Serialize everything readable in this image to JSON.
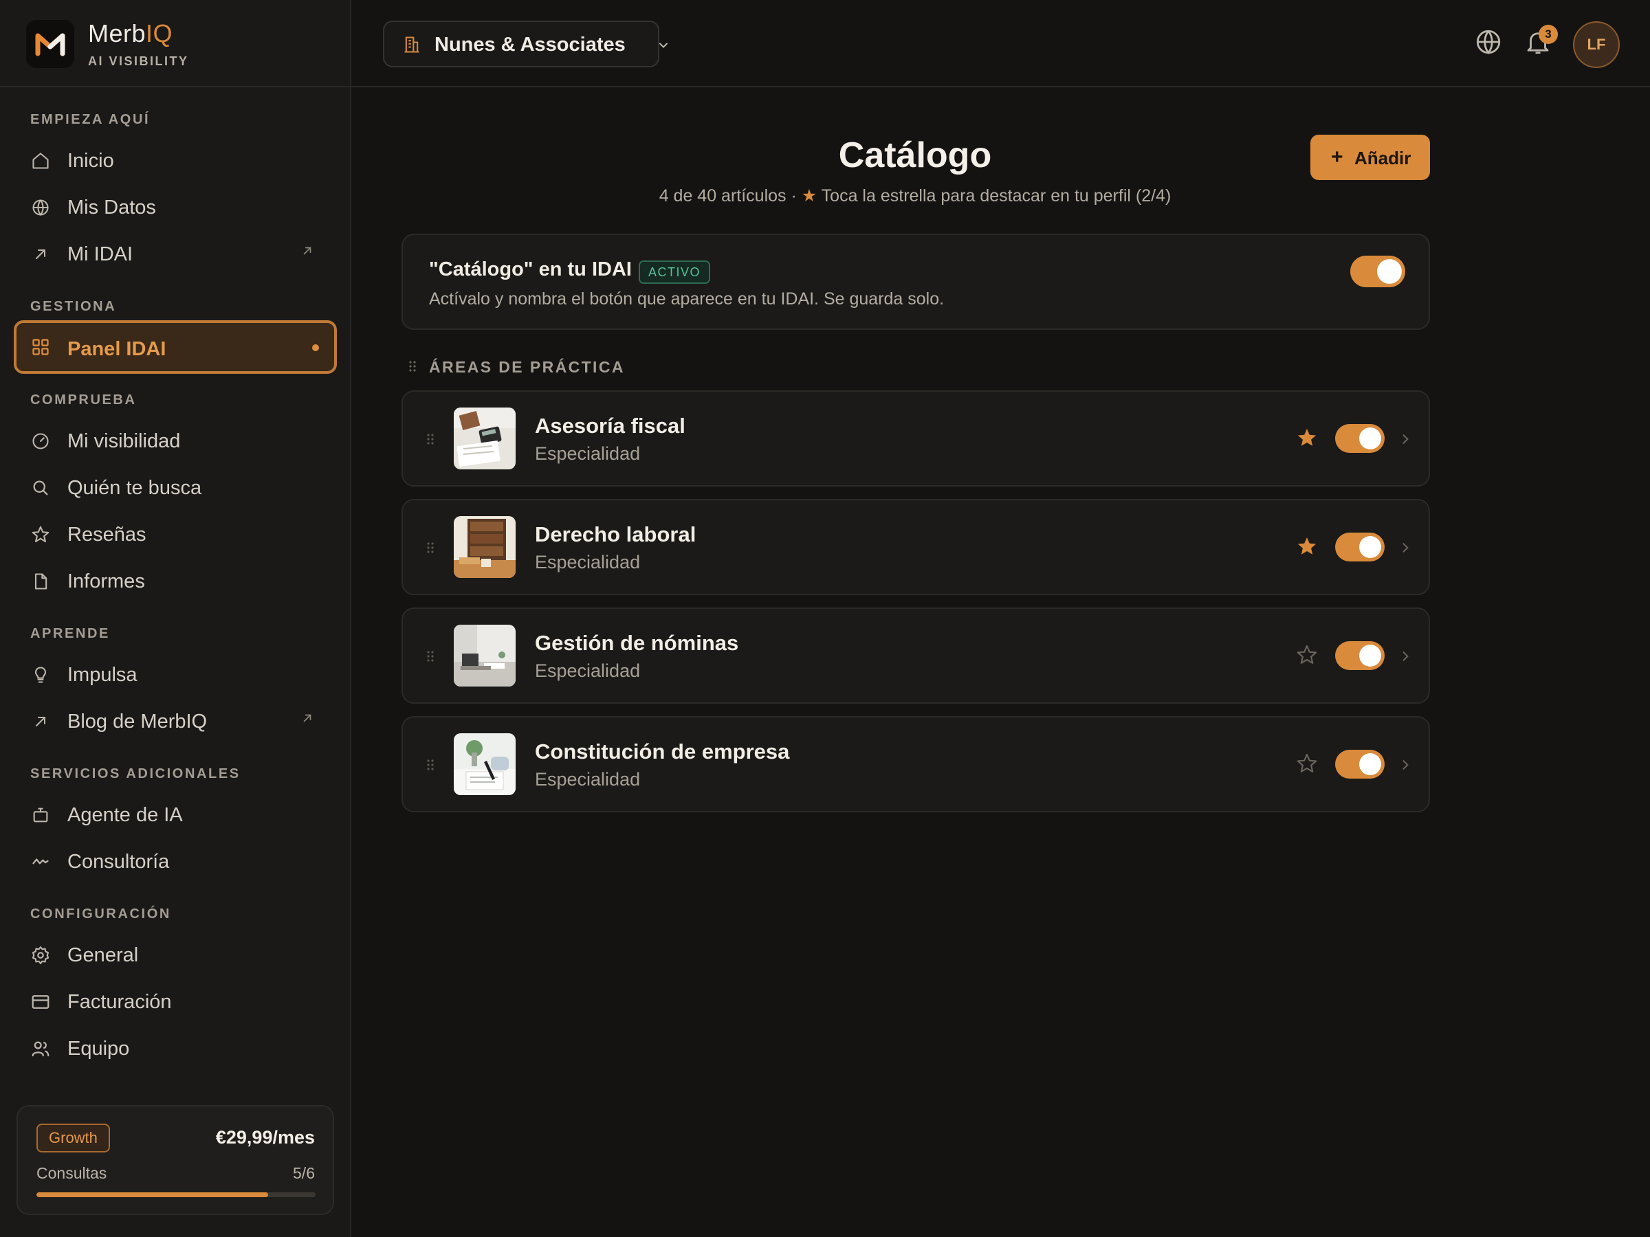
{
  "brand": {
    "name_prefix": "Merb",
    "name_suffix": "IQ",
    "subtitle": "AI VISIBILITY"
  },
  "sidebar": {
    "sections": [
      {
        "label": "EMPIEZA AQUÍ"
      },
      {
        "label": "GESTIONA"
      },
      {
        "label": "COMPRUEBA"
      },
      {
        "label": "APRENDE"
      },
      {
        "label": "SERVICIOS ADICIONALES"
      },
      {
        "label": "CONFIGURACIÓN"
      }
    ],
    "items": [
      {
        "label": "Inicio",
        "icon": "home-icon"
      },
      {
        "label": "Mis Datos",
        "icon": "globe-icon"
      },
      {
        "label": "Mi IDAI",
        "icon": "arrow-up-right-icon",
        "external": true
      },
      {
        "label": "Panel IDAI",
        "icon": "grid-icon",
        "active": true
      },
      {
        "label": "Mi visibilidad",
        "icon": "gauge-icon"
      },
      {
        "label": "Quién te busca",
        "icon": "search-icon"
      },
      {
        "label": "Reseñas",
        "icon": "star-icon"
      },
      {
        "label": "Informes",
        "icon": "document-icon"
      },
      {
        "label": "Impulsa",
        "icon": "lightbulb-icon"
      },
      {
        "label": "Blog de MerbIQ",
        "icon": "arrow-up-right-icon",
        "external": true
      },
      {
        "label": "Agente de IA",
        "icon": "robot-icon"
      },
      {
        "label": "Consultoría",
        "icon": "activity-icon"
      },
      {
        "label": "General",
        "icon": "gear-icon"
      },
      {
        "label": "Facturación",
        "icon": "credit-card-icon"
      },
      {
        "label": "Equipo",
        "icon": "users-icon"
      }
    ],
    "plan": {
      "name": "Growth",
      "price": "€29,99/mes",
      "usage_label": "Consultas",
      "usage_value": "5/6",
      "usage_fraction": 0.83
    }
  },
  "topbar": {
    "org_name": "Nunes & Associates",
    "notifications_count": "3",
    "avatar_initials": "LF"
  },
  "main": {
    "title": "Catálogo",
    "subtitle_prefix": "4 de 40 artículos · ",
    "subtitle_suffix": " Toca la estrella para destacar en tu perfil (2/4)",
    "add_label": "Añadir",
    "feature": {
      "title": "\"Catálogo\" en tu IDAI",
      "badge": "ACTIVO",
      "description": "Actívalo y nombra el botón que aparece en tu IDAI. Se guarda solo.",
      "enabled": true
    },
    "group_label": "ÁREAS DE PRÁCTICA",
    "items": [
      {
        "name": "Asesoría fiscal",
        "subtitle": "Especialidad",
        "starred": true,
        "enabled": true
      },
      {
        "name": "Derecho laboral",
        "subtitle": "Especialidad",
        "starred": true,
        "enabled": true
      },
      {
        "name": "Gestión de nóminas",
        "subtitle": "Especialidad",
        "starred": false,
        "enabled": true
      },
      {
        "name": "Constitución de empresa",
        "subtitle": "Especialidad",
        "starred": false,
        "enabled": true
      }
    ]
  },
  "colors": {
    "accent": "#d98a3a",
    "background": "#141312",
    "sidebar": "#1a1918",
    "active_badge": "#58c39a"
  }
}
